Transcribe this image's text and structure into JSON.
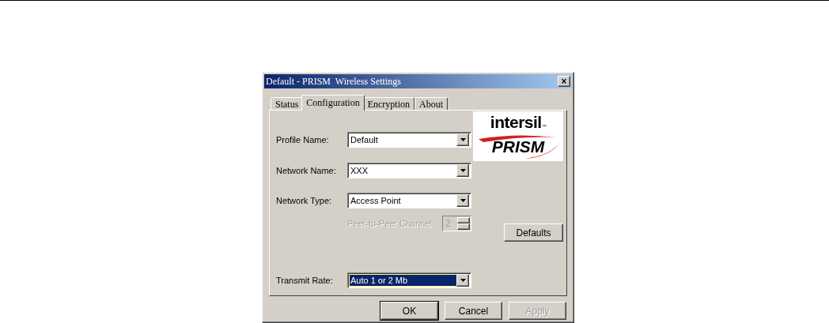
{
  "window": {
    "title": "Default - PRISM  Wireless Settings",
    "close": "×"
  },
  "tabs": [
    {
      "label": "Status",
      "selected": false
    },
    {
      "label": "Configuration",
      "selected": true
    },
    {
      "label": "Encryption",
      "selected": false
    },
    {
      "label": "About",
      "selected": false
    }
  ],
  "logo": {
    "company": "intersil",
    "trademark": "™",
    "product": "PRISM"
  },
  "fields": [
    {
      "kind": "combo",
      "label": "Profile Name:",
      "value": "Default",
      "focused": false,
      "disabled": false
    },
    {
      "kind": "combo",
      "label": "Network Name:",
      "value": "XXX",
      "focused": false,
      "disabled": false
    },
    {
      "kind": "combo",
      "label": "Network Type:",
      "value": "Access Point",
      "focused": false,
      "disabled": false
    },
    {
      "kind": "spin",
      "label": "Peer-to-Peer Channel:",
      "value": "2",
      "disabled": true
    },
    {
      "kind": "combo",
      "label": "Transmit Rate:",
      "value": "Auto 1 or 2 Mb",
      "focused": true,
      "disabled": false
    }
  ],
  "defaults_button": {
    "label": "Defaults",
    "disabled": false
  },
  "buttons": [
    {
      "label": "OK",
      "default": true,
      "disabled": false
    },
    {
      "label": "Cancel",
      "default": false,
      "disabled": false
    },
    {
      "label": "Apply",
      "default": false,
      "disabled": true
    }
  ]
}
